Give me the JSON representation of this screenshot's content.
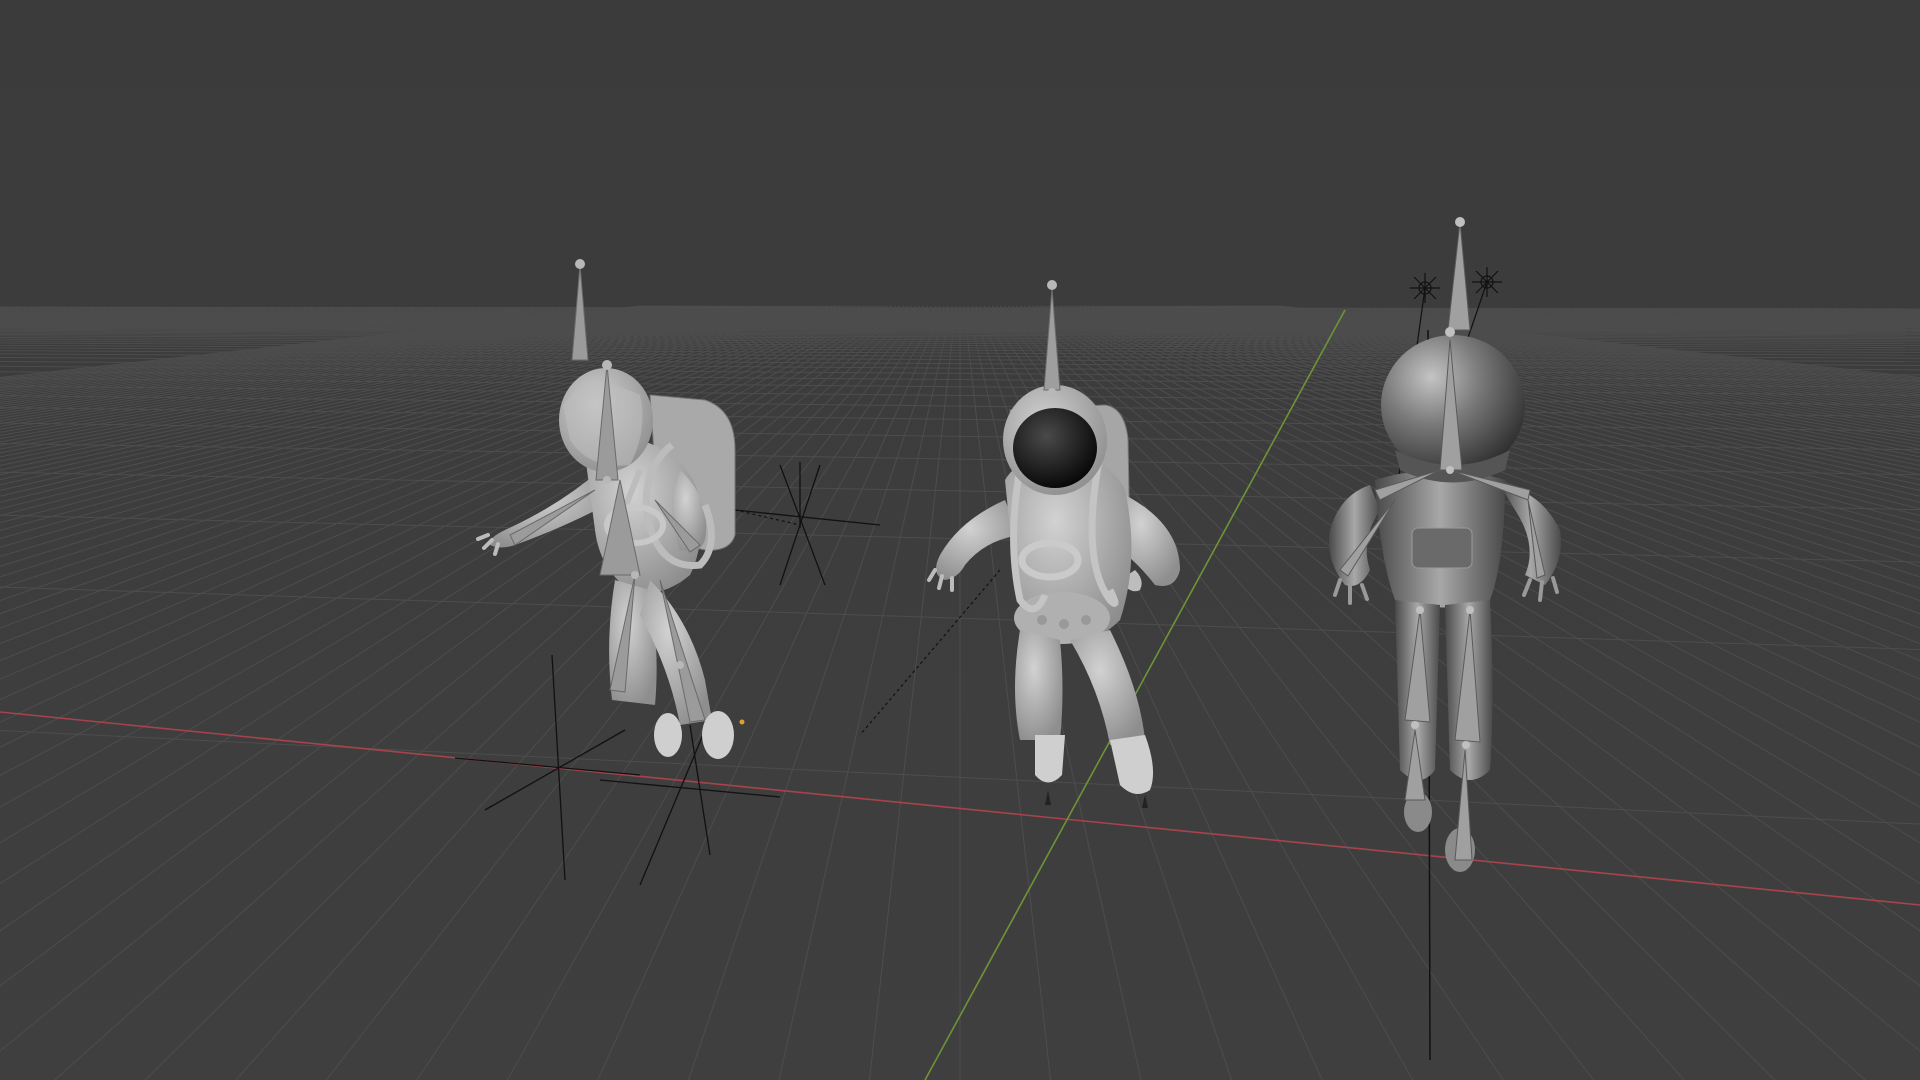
{
  "viewport": {
    "background": "#3d3d3d",
    "grid_color": "#555555",
    "x_axis_color": "#b0404a",
    "y_axis_color": "#7fa23a",
    "shading": "solid"
  },
  "objects": [
    {
      "name": "astronaut-rig-left",
      "type": "armature-and-mesh",
      "pose": "leaning"
    },
    {
      "name": "astronaut-mesh-center",
      "type": "mesh",
      "pose": "floating"
    },
    {
      "name": "astronaut-rig-right",
      "type": "armature-and-mesh",
      "material": "metallic"
    }
  ],
  "empties": [
    {
      "name": "empty-plain-axes-1",
      "icon": "plain-axes-icon"
    },
    {
      "name": "empty-plain-axes-2",
      "icon": "plain-axes-icon"
    },
    {
      "name": "empty-plain-axes-3",
      "icon": "plain-axes-icon"
    }
  ]
}
